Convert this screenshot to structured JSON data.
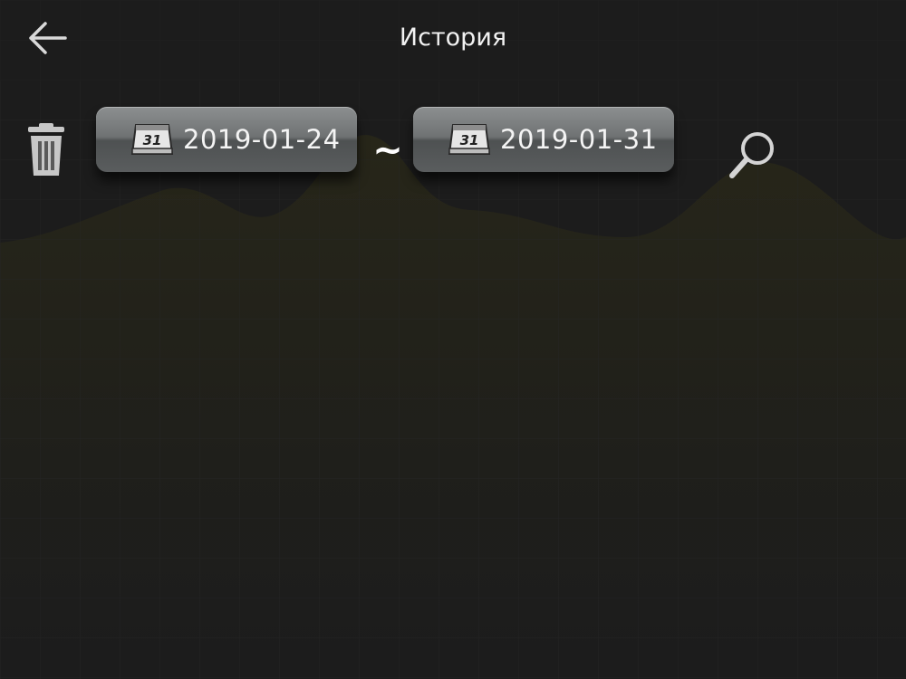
{
  "header": {
    "title": "История",
    "back_icon": "arrow-left-icon"
  },
  "toolbar": {
    "delete_icon": "trash-icon",
    "search_icon": "search-icon",
    "range_separator": "~"
  },
  "date_range": {
    "from": {
      "value": "2019-01-24",
      "icon_label": "31"
    },
    "to": {
      "value": "2019-01-31",
      "icon_label": "31"
    }
  },
  "colors": {
    "background": "#1c1c1c",
    "header_bg": "#1e1e1e",
    "chart_fill": "#23231c",
    "grid": "#262626",
    "text": "#f2f2f2",
    "icon": "#cfcfcf"
  }
}
